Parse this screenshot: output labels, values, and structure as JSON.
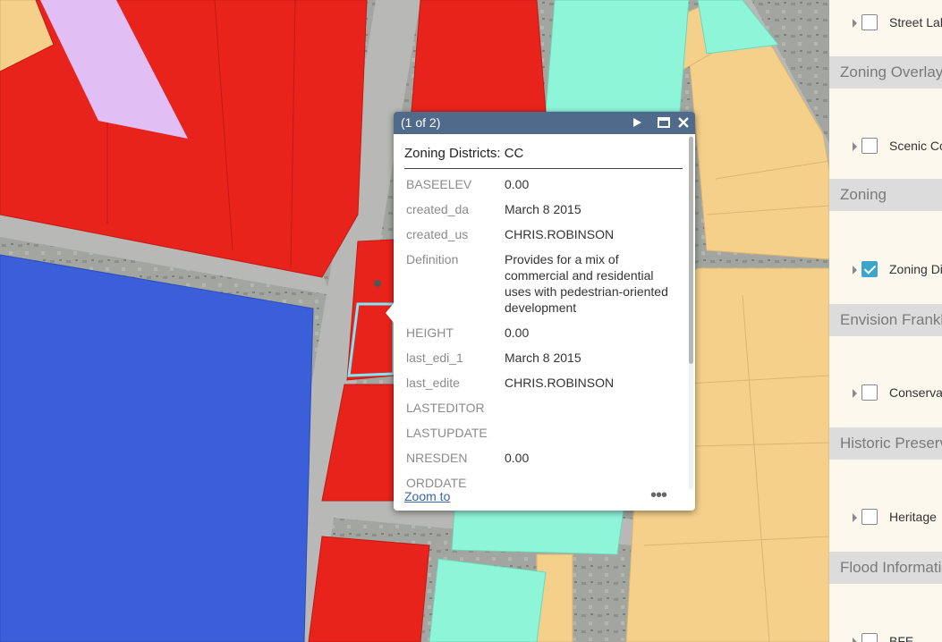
{
  "popup": {
    "count_label": "(1 of 2)",
    "title": "Zoning Districts: CC",
    "fields": [
      {
        "key": "BASEELEV",
        "value": "0.00"
      },
      {
        "key": "created_da",
        "value": "March 8 2015"
      },
      {
        "key": "created_us",
        "value": "CHRIS.ROBINSON"
      },
      {
        "key": "Definition",
        "value": "Provides for a mix of commercial and residential uses with pedestrian-oriented development"
      },
      {
        "key": "HEIGHT",
        "value": "0.00"
      },
      {
        "key": "last_edi_1",
        "value": "March 8 2015"
      },
      {
        "key": "last_edite",
        "value": "CHRIS.ROBINSON"
      },
      {
        "key": "LASTEDITOR",
        "value": ""
      },
      {
        "key": "LASTUPDATE",
        "value": ""
      },
      {
        "key": "NRESDEN",
        "value": "0.00"
      },
      {
        "key": "ORDDATE",
        "value": ""
      }
    ],
    "zoom_label": "Zoom to",
    "more_label": "•••"
  },
  "layers": {
    "items": [
      {
        "label": "Street Labels",
        "checked": false
      },
      {
        "header": "Zoning Overlay"
      },
      {
        "label": "Scenic Corridor",
        "checked": false
      },
      {
        "header": "Zoning"
      },
      {
        "label": "Zoning Districts",
        "checked": true
      },
      {
        "header": "Envision Franklin"
      },
      {
        "label": "Conservation",
        "checked": false
      },
      {
        "header": "Historic Preservation"
      },
      {
        "label": "Heritage",
        "checked": false
      },
      {
        "header": "Flood Information"
      },
      {
        "label": "BFE",
        "checked": false
      }
    ]
  },
  "colors": {
    "commercial": "#e8231c",
    "residential_blue": "#3a5fd8",
    "yellow": "#f5d08a",
    "mint": "#8ff5d9",
    "lavender": "#e1bff5",
    "selection": "#7fe6f6",
    "popup_header": "#4f6a8a",
    "checkbox_on": "#3da5c9"
  }
}
